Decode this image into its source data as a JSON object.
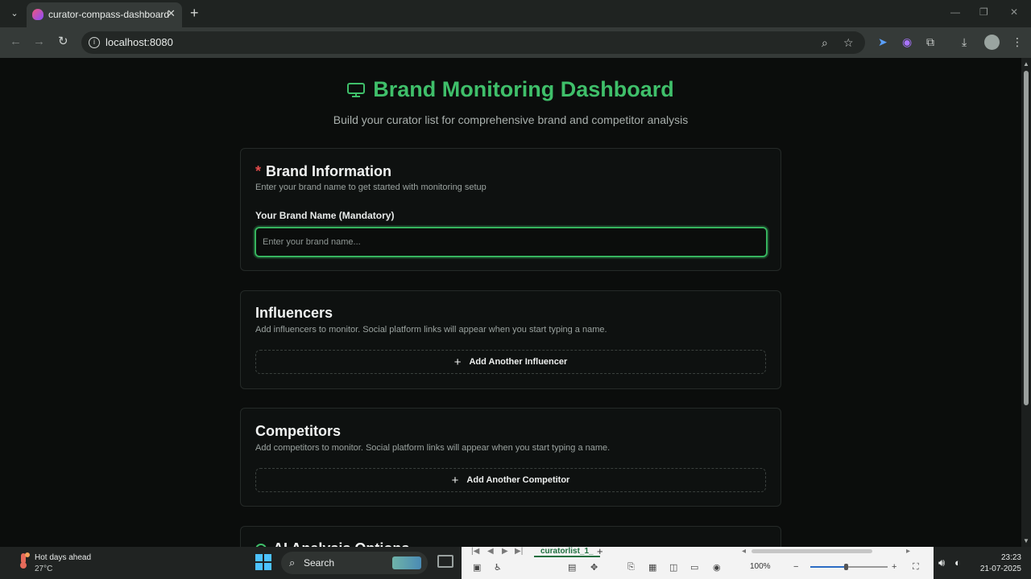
{
  "browser": {
    "tab_title": "curator-compass-dashboard",
    "url": "localhost:8080"
  },
  "header": {
    "title": "Brand Monitoring Dashboard",
    "subtitle": "Build your curator list for comprehensive brand and competitor analysis"
  },
  "brand_card": {
    "required_marker": "*",
    "title": "Brand Information",
    "description": "Enter your brand name to get started with monitoring setup",
    "field_label": "Your Brand Name (Mandatory)",
    "input_placeholder": "Enter your brand name...",
    "input_value": ""
  },
  "influencers_card": {
    "title": "Influencers",
    "description": "Add influencers to monitor. Social platform links will appear when you start typing a name.",
    "add_button_label": "Add Another Influencer"
  },
  "competitors_card": {
    "title": "Competitors",
    "description": "Add competitors to monitor. Social platform links will appear when you start typing a name.",
    "add_button_label": "Add Another Competitor"
  },
  "ai_card": {
    "title": "AI Analysis Options"
  },
  "taskbar": {
    "weather_main": "Hot days ahead",
    "weather_temp": "27°C",
    "search_label": "Search",
    "excel_sheet_tab": "curatorlist_1_",
    "excel_zoom": "100%",
    "time": "23:23",
    "date": "21-07-2025"
  },
  "colors": {
    "accent_green": "#3fbf6a",
    "required_red": "#e24b4b",
    "page_background": "#0b0d0c"
  }
}
